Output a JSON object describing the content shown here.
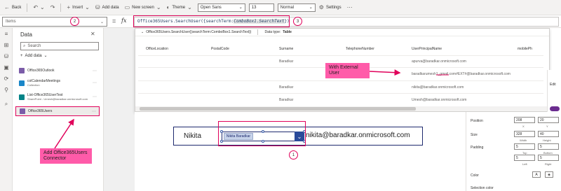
{
  "toolbar": {
    "back": "Back",
    "insert": "Insert",
    "add_data": "Add data",
    "new_screen": "New screen",
    "theme": "Theme",
    "font": "Open Sans",
    "font_size": "13",
    "font_weight": "Normal",
    "settings": "Settings"
  },
  "formula_bar": {
    "property": "Items",
    "fx": "fx",
    "formula_pre": "Office365Users.SearchUser({searchTerm:",
    "formula_hl": "ComboBox1.SearchText",
    "formula_post": "})"
  },
  "data_panel": {
    "title": "Data",
    "search_placeholder": "Search",
    "add_data": "Add data",
    "sources": [
      {
        "name": "Office365Outlook",
        "sub": ""
      },
      {
        "name": "colCalendarMeetings",
        "sub": "Collection"
      },
      {
        "name": "List-Office365UserTest",
        "sub": "SharePoint - Umesh@baradkar.onmicrosoft.com"
      },
      {
        "name": "Office365Users",
        "sub": ""
      }
    ]
  },
  "data_popup": {
    "expr": "Office365Users.SearchUser({searchTerm:ComboBox1.SearchText})",
    "type_label": "Data type:",
    "type_value": "Table",
    "columns": [
      "OfficeLocation",
      "PostalCode",
      "Surname",
      "TelephoneNumber",
      "UserPrincipalName",
      "mobilePh"
    ],
    "rows": [
      {
        "surname": "Baradkar",
        "upn": "apurva@baradkar.onmicrosoft.com"
      },
      {
        "surname": "",
        "upn": "baradkarumesh1_gmail.com#EXT#@baradkar.onmicrosoft.com"
      },
      {
        "surname": "Baradkar",
        "upn": "nikita@baradkar.onmicrosoft.com"
      },
      {
        "surname": "Baradkar",
        "upn": "Umesh@baradkar.onmicrosoft.com"
      }
    ]
  },
  "app": {
    "name_label": "Nikita",
    "combo_value": "Nikita Baradkar",
    "email": "nikita@baradkar.onmicrosoft.com"
  },
  "properties": {
    "position": "Position",
    "x": "208",
    "y": "20",
    "x_lbl": "X",
    "y_lbl": "Y",
    "size": "Size",
    "w": "328",
    "h": "40",
    "w_lbl": "Width",
    "h_lbl": "Height",
    "padding": "Padding",
    "pad_top": "5",
    "pad_bottom": "5",
    "top_lbl": "Top",
    "bottom_lbl": "Bottom",
    "pad_left": "5",
    "pad_right": "5",
    "left_lbl": "Left",
    "right_lbl": "Right",
    "color": "Color",
    "selection_color": "Selection color",
    "edit": "Edit"
  },
  "annotations": {
    "badge1": "1",
    "badge2": "2",
    "badge3": "3",
    "callout_connector": "Add Office365Users Connector",
    "callout_external": "With External User"
  },
  "colors": {
    "accent": "#e0005a",
    "callout": "#ff5ba9",
    "app_border": "#1e2a6e"
  }
}
